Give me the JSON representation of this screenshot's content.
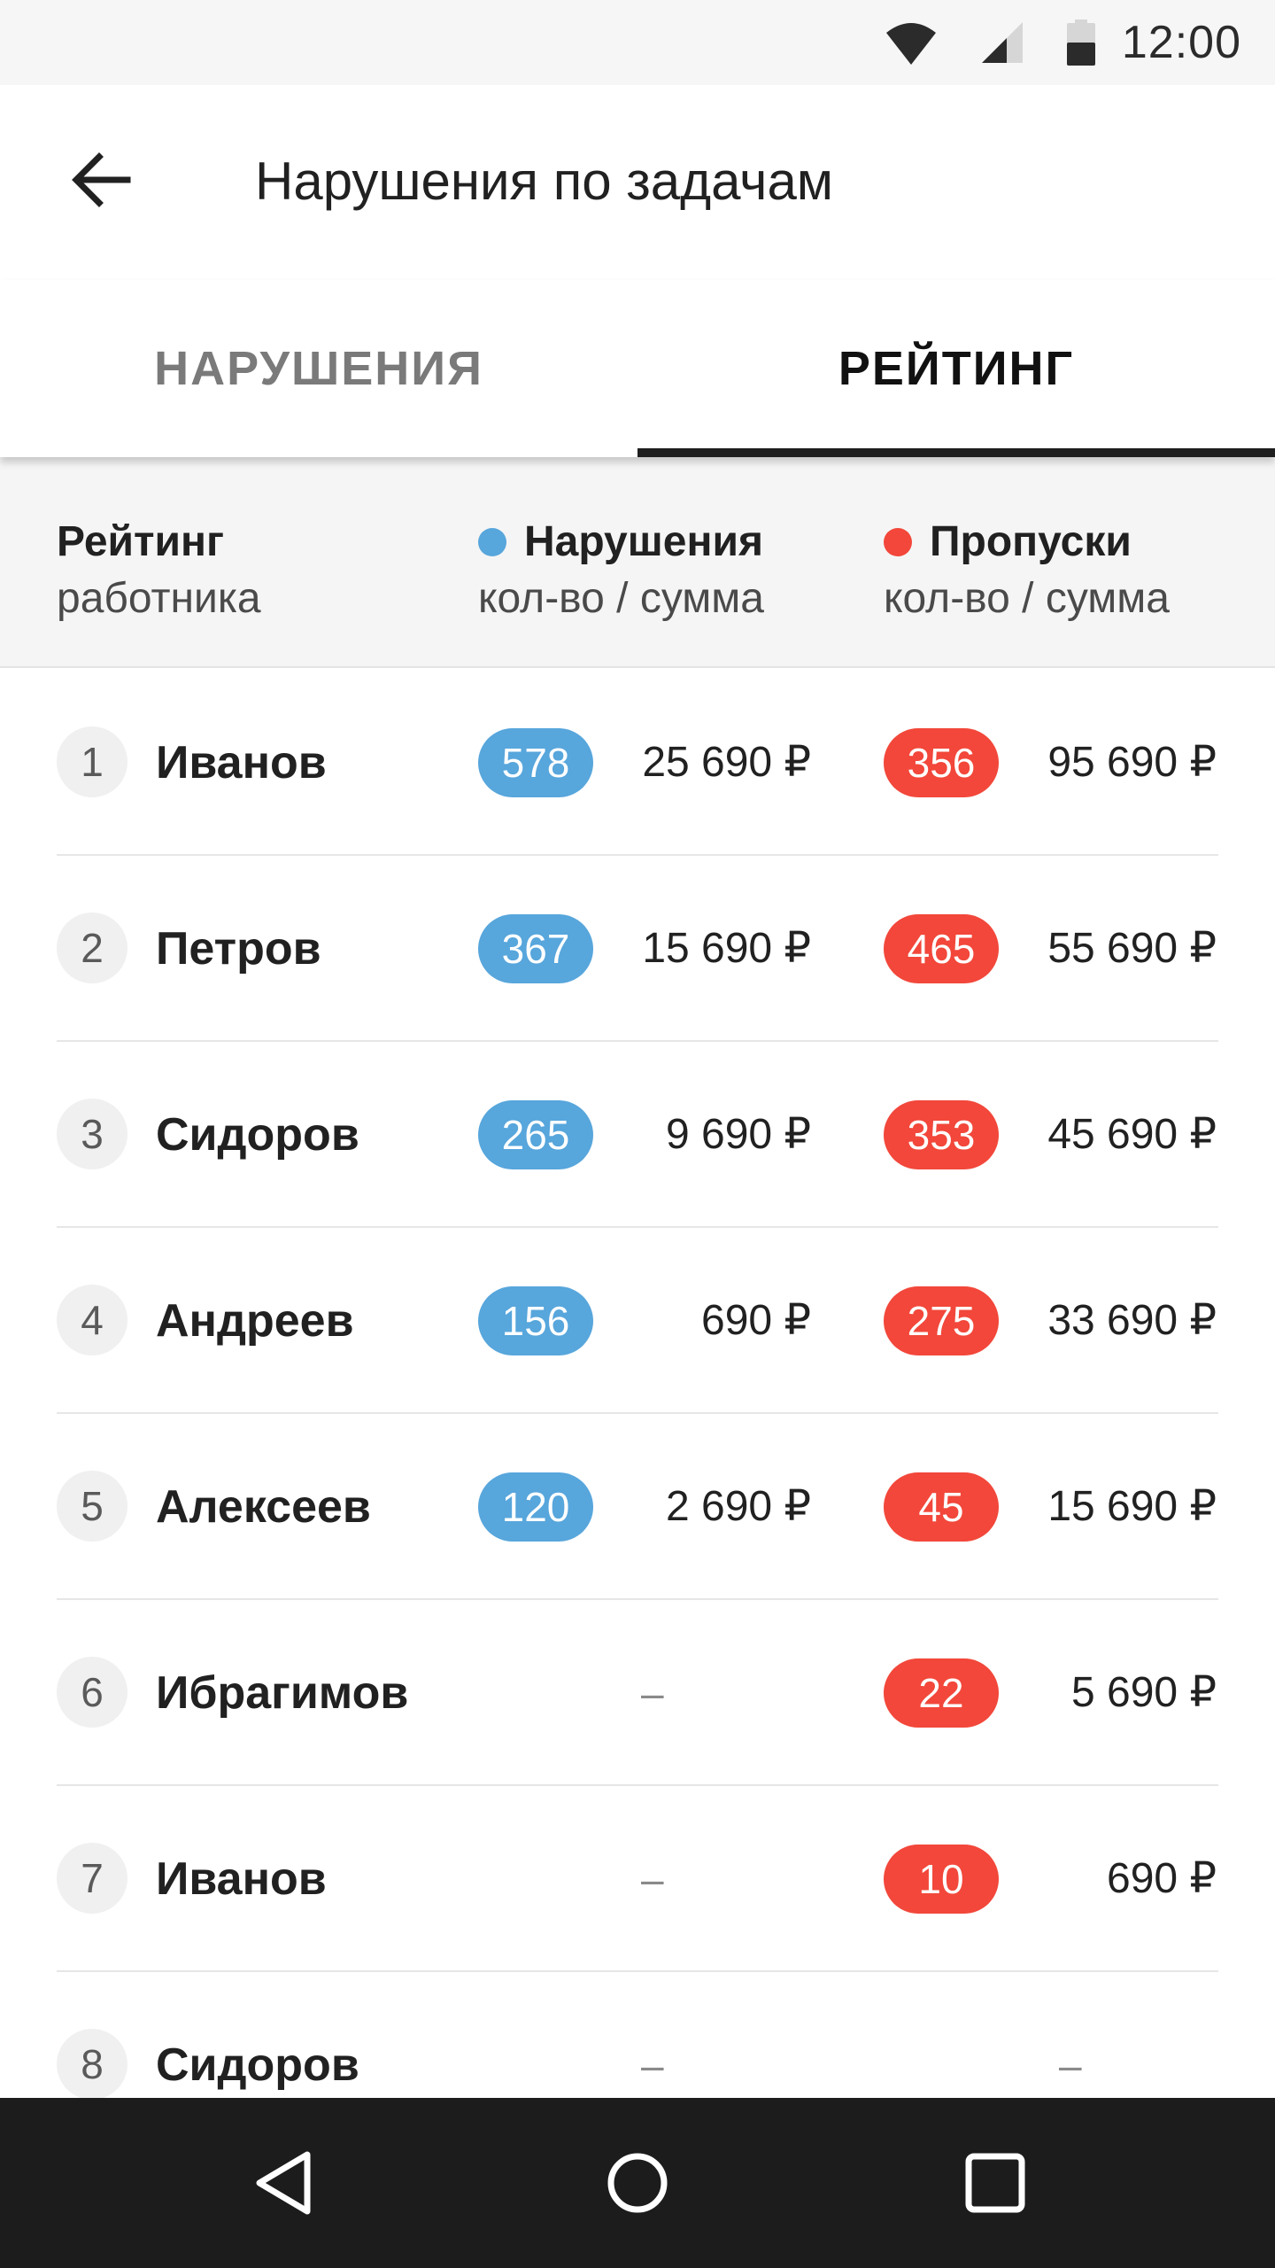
{
  "status_bar": {
    "time": "12:00",
    "icons": [
      "wifi-icon",
      "signal-icon",
      "battery-icon"
    ]
  },
  "app_bar": {
    "title": "Нарушения по задачам",
    "back_icon": "arrow-left-icon"
  },
  "tabs": [
    {
      "label": "НАРУШЕНИЯ",
      "active": false
    },
    {
      "label": "РЕЙТИНГ",
      "active": true
    }
  ],
  "columns": {
    "rating": {
      "title": "Рейтинг",
      "subtitle": "работника"
    },
    "violations": {
      "title": "Нарушения",
      "subtitle": "кол-во / сумма",
      "color": "#57a6dc"
    },
    "absences": {
      "title": "Пропуски",
      "subtitle": "кол-во / сумма",
      "color": "#f2473a"
    }
  },
  "rows": [
    {
      "rank": "1",
      "name": "Иванов",
      "violations_count": "578",
      "violations_sum": "25 690 ₽",
      "absences_count": "356",
      "absences_sum": "95 690 ₽"
    },
    {
      "rank": "2",
      "name": "Петров",
      "violations_count": "367",
      "violations_sum": "15 690 ₽",
      "absences_count": "465",
      "absences_sum": "55 690 ₽"
    },
    {
      "rank": "3",
      "name": "Сидоров",
      "violations_count": "265",
      "violations_sum": "9 690 ₽",
      "absences_count": "353",
      "absences_sum": "45 690 ₽"
    },
    {
      "rank": "4",
      "name": "Андреев",
      "violations_count": "156",
      "violations_sum": "690 ₽",
      "absences_count": "275",
      "absences_sum": "33 690 ₽"
    },
    {
      "rank": "5",
      "name": "Алексеев",
      "violations_count": "120",
      "violations_sum": "2 690 ₽",
      "absences_count": "45",
      "absences_sum": "15 690 ₽"
    },
    {
      "rank": "6",
      "name": "Ибрагимов",
      "violations_empty": "–",
      "absences_count": "22",
      "absences_sum": "5 690 ₽"
    },
    {
      "rank": "7",
      "name": "Иванов",
      "violations_empty": "–",
      "absences_count": "10",
      "absences_sum": "690 ₽"
    },
    {
      "rank": "8",
      "name": "Сидоров",
      "violations_empty": "–",
      "absences_empty": "–"
    }
  ],
  "nav_bar": {
    "buttons": [
      "nav-back-icon",
      "nav-home-icon",
      "nav-recents-icon"
    ]
  },
  "colors": {
    "violations": "#57a6dc",
    "absences": "#f2473a",
    "tab_indicator": "#1e1e1e",
    "nav_bar": "#1c1c1c"
  }
}
